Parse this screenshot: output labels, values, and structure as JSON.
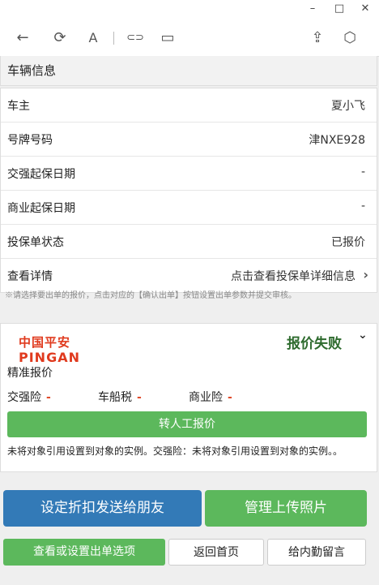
{
  "window": {
    "minimize": "–",
    "maximize": "□",
    "close": "✕"
  },
  "toolbar": {
    "back_icon": "←",
    "refresh_icon": "⟳",
    "font_icon": "A",
    "link_icon": "⊂⊃",
    "tab_icon": "▭",
    "share_icon": "⇪",
    "cube_icon": "⬡"
  },
  "vehicle": {
    "title": "车辆信息",
    "rows": [
      {
        "label": "车主",
        "value": "夏小飞"
      },
      {
        "label": "号牌号码",
        "value": "津NXE928"
      },
      {
        "label": "交强起保日期",
        "value": "-"
      },
      {
        "label": "商业起保日期",
        "value": "-"
      },
      {
        "label": "投保单状态",
        "value": "已报价"
      },
      {
        "label": "查看详情",
        "value": "点击查看投保单详细信息"
      }
    ]
  },
  "note": "※请选择要出单的报价，点击对应的【确认出单】按钮设置出单参数并提交审核。",
  "quote": {
    "logo_cn": "中国平安",
    "logo_en": "PINGAN",
    "status": "报价失败",
    "type": "精准报价",
    "insurances": [
      {
        "name": "交强险",
        "value": "-"
      },
      {
        "name": "车船税",
        "value": "-"
      },
      {
        "name": "商业险",
        "value": "-"
      }
    ],
    "manual_button": "转人工报价",
    "error": "未将对象引用设置到对象的实例。交强险：未将对象引用设置到对象的实例。。"
  },
  "actions": {
    "share_discount": "设定折扣发送给朋友",
    "manage_photos": "管理上传照片",
    "view_options": "查看或设置出单选项",
    "home": "返回首页",
    "message": "给内勤留言"
  },
  "colors": {
    "blue": "#337ab7",
    "green": "#5cb85c",
    "status_green": "#2e6b2e",
    "pingan_orange": "#e03a1e"
  }
}
